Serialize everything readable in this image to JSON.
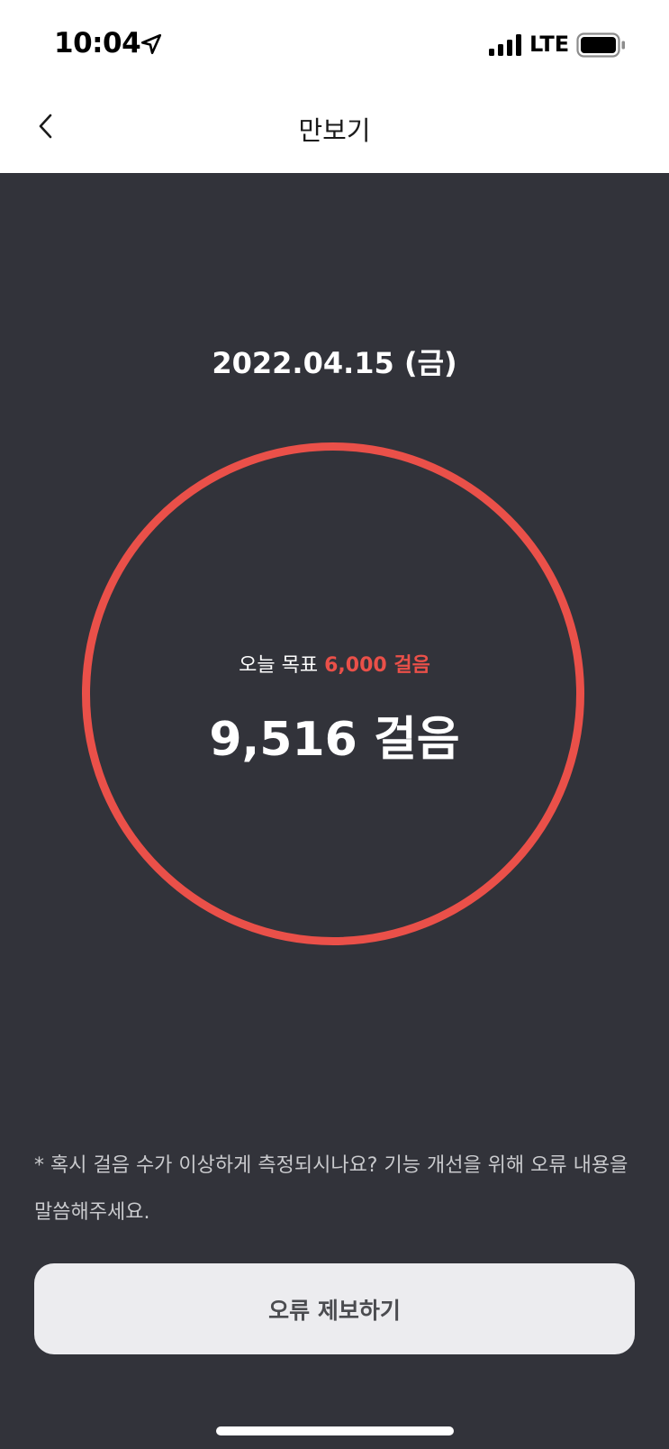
{
  "status_bar": {
    "time": "10:04",
    "network": "LTE",
    "icons": [
      "location-arrow-icon",
      "cellular-signal-icon",
      "battery-icon"
    ]
  },
  "nav": {
    "title": "만보기",
    "back_icon": "chevron-left-icon"
  },
  "pedometer": {
    "date": "2022.04.15 (금)",
    "goal_prefix": "오늘 목표",
    "goal_value": "6,000 걸음",
    "steps": "9,516 걸음",
    "goal_steps": 6000,
    "current_steps": 9516
  },
  "notice": {
    "text": "* 혹시 걸음 수가 이상하게 측정되시나요? 기능 개선을 위해 오류 내용을 말씀해주세요."
  },
  "report_button": {
    "label": "오류 제보하기"
  },
  "colors": {
    "background": "#32333a",
    "accent": "#ea5049",
    "button_bg": "#ececef",
    "header_bg": "#ffffff"
  }
}
